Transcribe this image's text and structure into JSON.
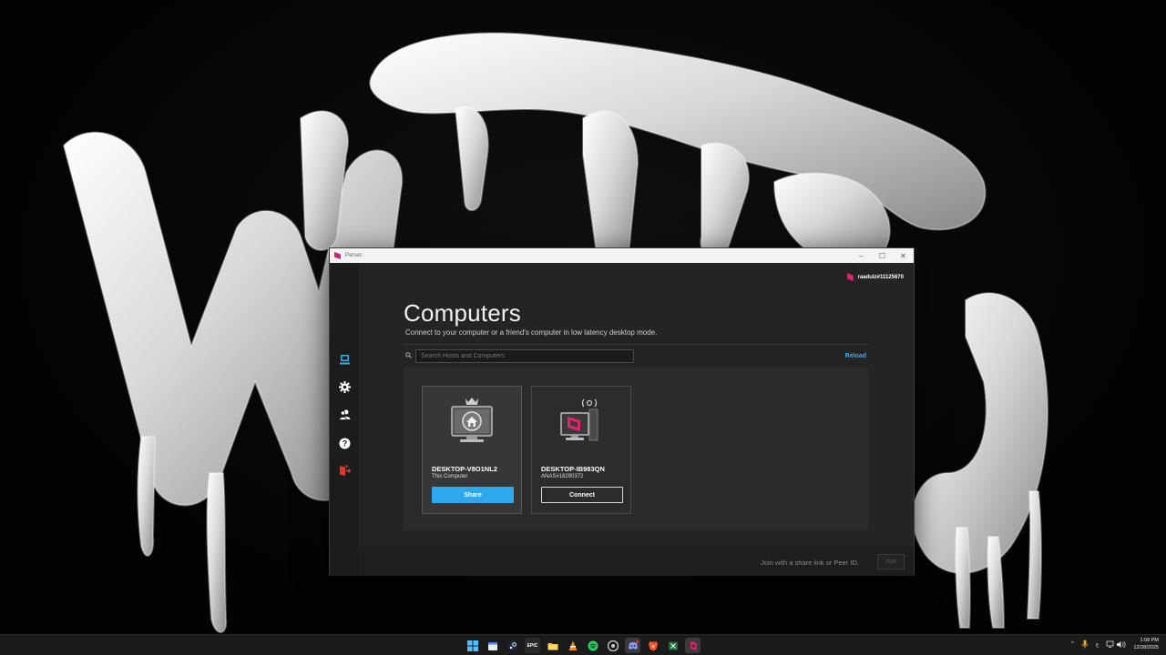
{
  "window": {
    "title": "Parsec",
    "controls": {
      "minimize": "–",
      "maximize": "☐",
      "close": "✕"
    }
  },
  "user": {
    "name": "raadulz#11125670"
  },
  "sidebar": {
    "items": [
      {
        "name": "computers",
        "icon": "computer-icon",
        "active": true
      },
      {
        "name": "settings",
        "icon": "gear-icon"
      },
      {
        "name": "friends",
        "icon": "friends-icon"
      },
      {
        "name": "help",
        "icon": "help-icon"
      },
      {
        "name": "logout",
        "icon": "logout-icon"
      }
    ]
  },
  "main": {
    "heading": "Computers",
    "subheading": "Connect to your computer or a friend's computer in low latency desktop mode.",
    "search_placeholder": "Search Hosts and Computers",
    "reload_label": "Reload"
  },
  "computers": [
    {
      "name": "DESKTOP-V8O1NL2",
      "subtitle": "This Computer",
      "button": "Share"
    },
    {
      "name": "DESKTOP-IB983QN",
      "subtitle": "ANAS#18290372",
      "button": "Connect"
    }
  ],
  "footer": {
    "hint": "Join with a share link or Peer ID.",
    "join_label": "Join"
  },
  "taskbar": {
    "icons": [
      "windows-start-icon",
      "calendar-icon",
      "steam-icon",
      "epic-games-icon",
      "file-explorer-icon",
      "vlc-icon",
      "spotify-icon",
      "chrome-icon",
      "discord-icon",
      "brave-icon",
      "excel-icon",
      "parsec-icon"
    ],
    "epic_label": "EPIC",
    "language": "ع",
    "time": "1:58 PM",
    "date": "12/28/2025"
  },
  "colors": {
    "accent": "#2ea8ec",
    "brand": "#e0246f",
    "logout": "#e3342f"
  }
}
